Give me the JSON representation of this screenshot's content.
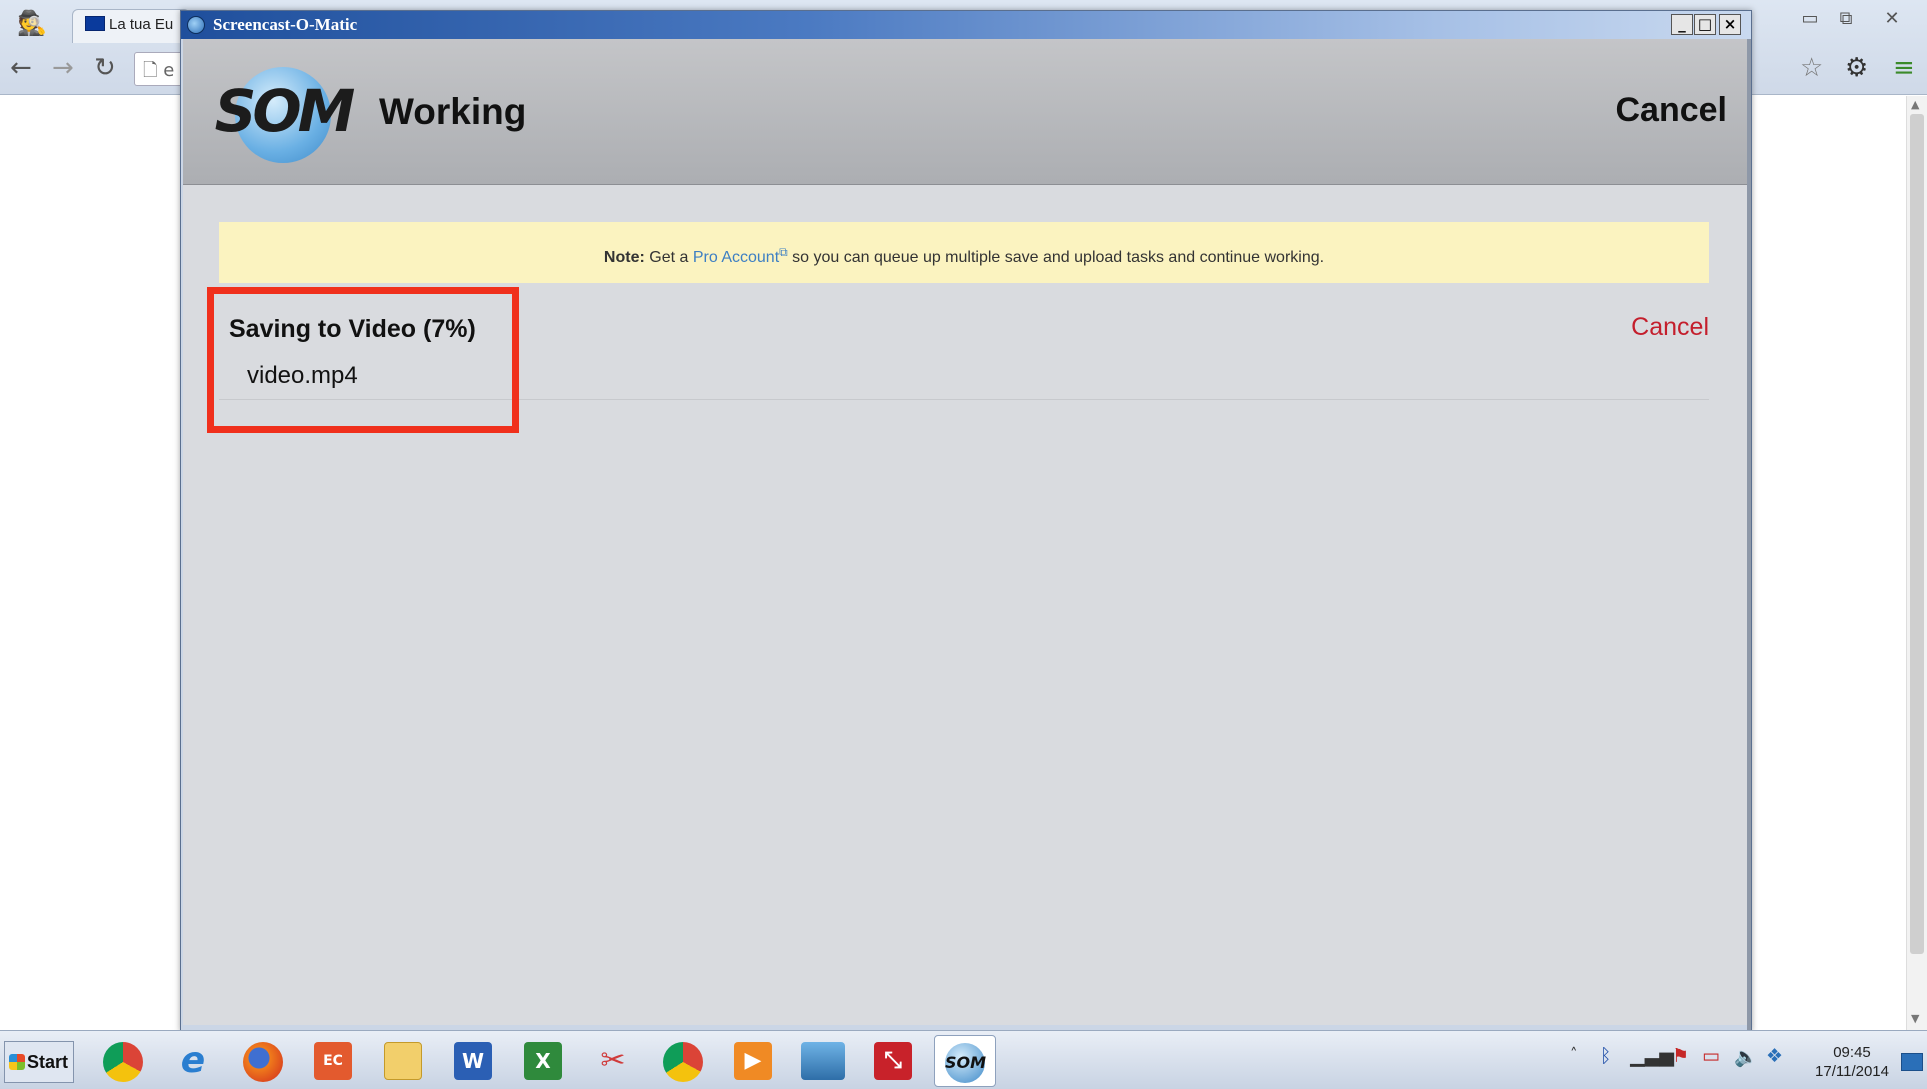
{
  "browser": {
    "tab_title": "La tua Eu",
    "omnibox_text": "e",
    "icons": {
      "incognito": "incognito-icon",
      "back": "back-arrow-icon",
      "forward": "forward-arrow-icon",
      "reload": "reload-icon",
      "page": "page-icon",
      "star": "star-icon",
      "gear": "gear-icon",
      "menu": "hamburger-menu-icon"
    }
  },
  "window": {
    "title": "Screencast-O-Matic",
    "controls": {
      "minimize": "_",
      "maximize": "□",
      "close": "×"
    }
  },
  "header": {
    "logo_text": "SOM",
    "title": "Working",
    "cancel_label": "Cancel"
  },
  "note": {
    "label": "Note:",
    "text_before": "Get a",
    "link": "Pro Account",
    "text_after": "so you can queue up multiple save and upload tasks and continue working."
  },
  "task": {
    "title": "Saving to Video (7%)",
    "progress_percent": 7,
    "filename": "video.mp4",
    "cancel_label": "Cancel"
  },
  "colors": {
    "note_background": "#fbf3c0",
    "link_blue": "#3d7fc3",
    "cancel_red": "#c41e2c",
    "highlight_red": "#f0301c"
  },
  "taskbar": {
    "start_label": "Start",
    "apps": [
      {
        "name": "chrome-icon"
      },
      {
        "name": "internet-explorer-icon"
      },
      {
        "name": "firefox-icon"
      },
      {
        "name": "screen-recorder-icon"
      },
      {
        "name": "file-explorer-icon"
      },
      {
        "name": "word-icon",
        "glyph": "W"
      },
      {
        "name": "excel-icon",
        "glyph": "X"
      },
      {
        "name": "snipping-tool-icon"
      },
      {
        "name": "chrome-icon"
      },
      {
        "name": "media-player-icon"
      },
      {
        "name": "photo-viewer-icon"
      },
      {
        "name": "acrobat-icon"
      },
      {
        "name": "screencast-o-matic-icon",
        "glyph": "SOM"
      }
    ],
    "clock_time": "09:45",
    "clock_date": "17/11/2014"
  }
}
